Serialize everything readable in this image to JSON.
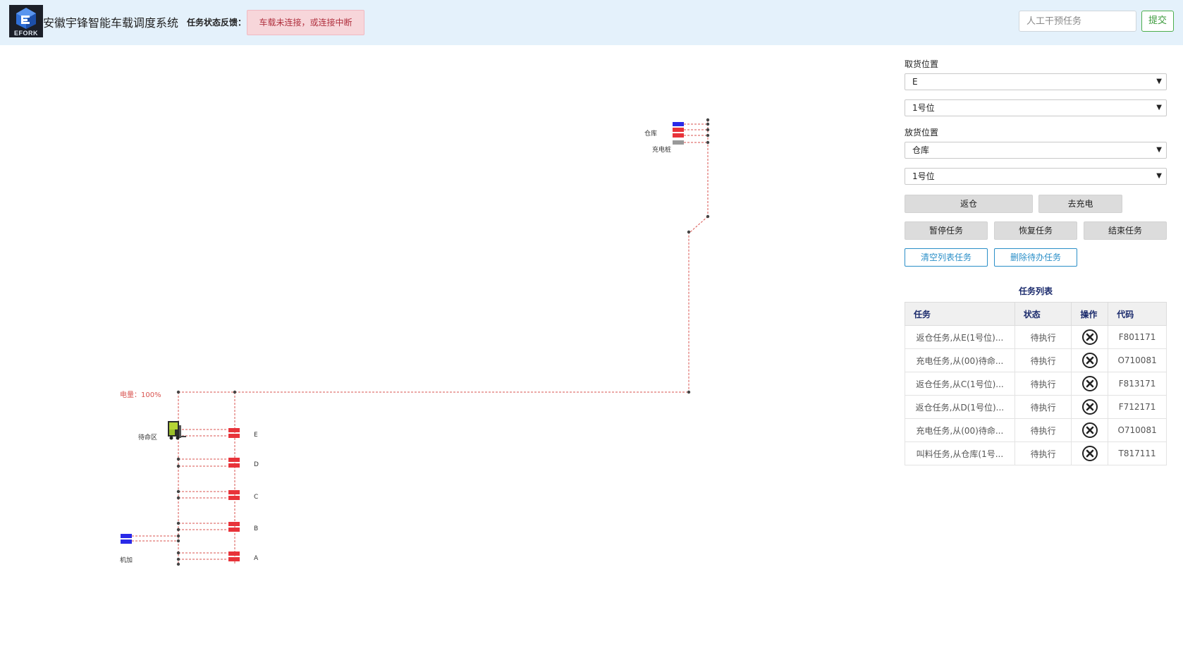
{
  "header": {
    "logo_text": "EFORK",
    "app_title": "安徽宇锋智能车载调度系统",
    "feedback_label": "任务状态反馈：",
    "feedback_value": "车载未连接，或连接中断",
    "intervene_placeholder": "人工干预任务",
    "submit_label": "提交"
  },
  "map": {
    "battery_text": "电量：100%",
    "labels": {
      "warehouse": "仓库",
      "charging": "充电桩",
      "standby": "待命区",
      "machining": "机加",
      "E": "E",
      "D": "D",
      "C": "C",
      "B": "B",
      "A": "A"
    },
    "colors": {
      "route": "#d9534f",
      "node": "#444444",
      "red_block": "#e8333a",
      "blue_block": "#2a2ae8",
      "gray_block": "#999999",
      "battery_text": "#d9534f"
    }
  },
  "panel": {
    "pickup_label": "取货位置",
    "pickup_area": "E",
    "pickup_slot": "1号位",
    "drop_label": "放货位置",
    "drop_area": "仓库",
    "drop_slot": "1号位",
    "btn_return": "返仓",
    "btn_charge": "去充电",
    "btn_pause": "暂停任务",
    "btn_resume": "恢复任务",
    "btn_end": "结束任务",
    "btn_clear": "清空列表任务",
    "btn_delete": "删除待办任务",
    "task_list_title": "任务列表",
    "columns": [
      "任务",
      "状态",
      "操作",
      "代码"
    ],
    "tasks": [
      {
        "task": "返仓任务,从E(1号位)...",
        "status": "待执行",
        "code": "F801171"
      },
      {
        "task": "充电任务,从(00)待命...",
        "status": "待执行",
        "code": "O710081"
      },
      {
        "task": "返仓任务,从C(1号位)...",
        "status": "待执行",
        "code": "F813171"
      },
      {
        "task": "返仓任务,从D(1号位)...",
        "status": "待执行",
        "code": "F712171"
      },
      {
        "task": "充电任务,从(00)待命...",
        "status": "待执行",
        "code": "O710081"
      },
      {
        "task": "叫料任务,从仓库(1号...",
        "status": "待执行",
        "code": "T817111"
      }
    ]
  }
}
